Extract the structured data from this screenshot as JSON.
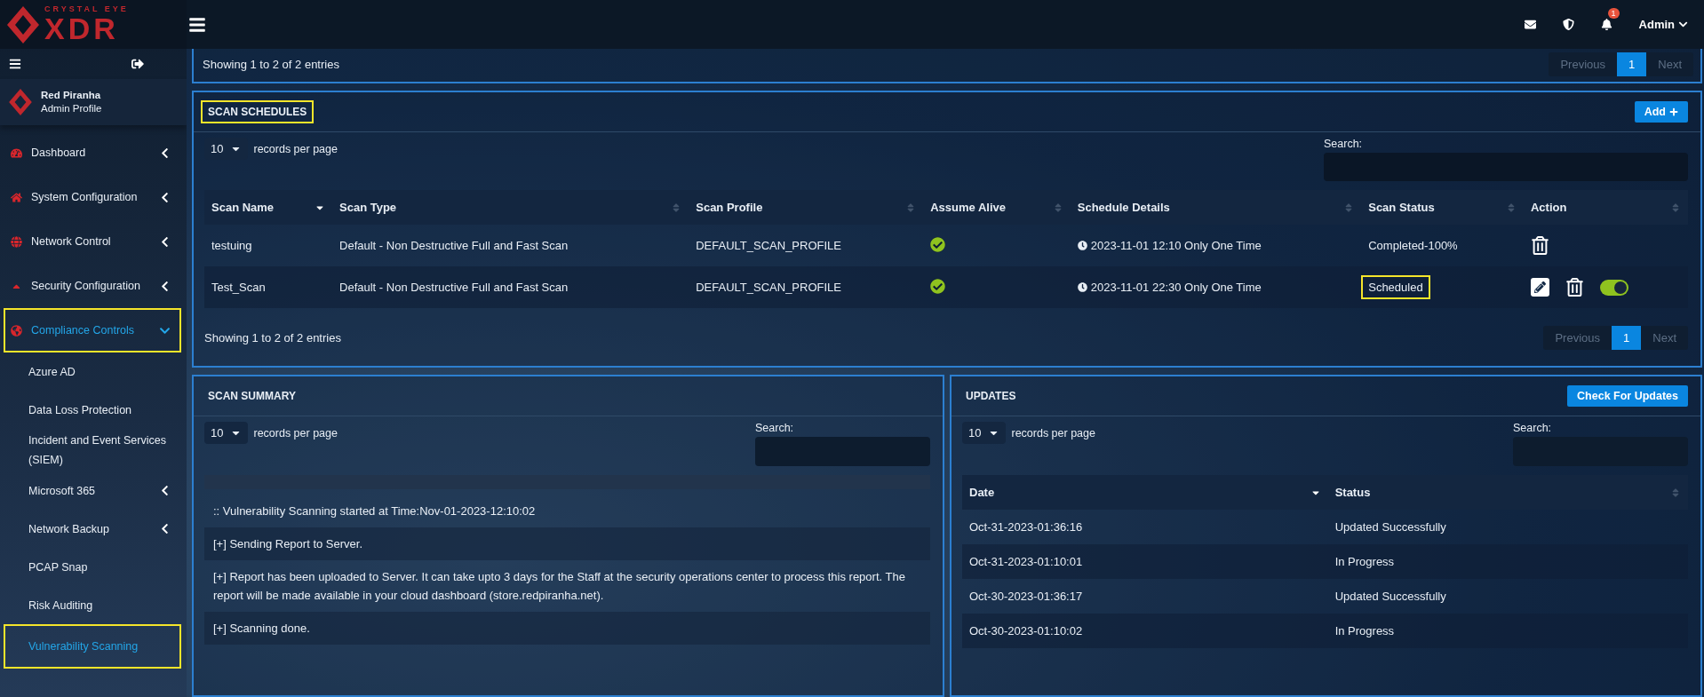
{
  "brand": {
    "top": "CRYSTAL EYE",
    "main": "XDR"
  },
  "header": {
    "notifications": "1",
    "user": "Admin"
  },
  "profile": {
    "name": "Red Piranha",
    "role": "Admin Profile"
  },
  "sidebar": {
    "items": [
      {
        "label": "Dashboard",
        "selected": false,
        "highlighted": false,
        "expanded": false
      },
      {
        "label": "System Configuration",
        "selected": false,
        "highlighted": false,
        "expanded": false
      },
      {
        "label": "Network Control",
        "selected": false,
        "highlighted": false,
        "expanded": false
      },
      {
        "label": "Security Configuration",
        "selected": false,
        "highlighted": false,
        "expanded": false
      },
      {
        "label": "Compliance Controls",
        "selected": true,
        "highlighted": true,
        "expanded": true,
        "children": [
          {
            "label": "Azure AD",
            "selected": false,
            "highlighted": false
          },
          {
            "label": "Data Loss Protection",
            "selected": false,
            "highlighted": false
          },
          {
            "label": "Incident and Event Services (SIEM)",
            "selected": false,
            "highlighted": false
          },
          {
            "label": "Microsoft 365",
            "selected": false,
            "highlighted": false,
            "expanded": false
          },
          {
            "label": "Network Backup",
            "selected": false,
            "highlighted": false,
            "expanded": false
          },
          {
            "label": "PCAP Snap",
            "selected": false,
            "highlighted": false
          },
          {
            "label": "Risk Auditing",
            "selected": false,
            "highlighted": false
          },
          {
            "label": "Vulnerability Scanning",
            "selected": true,
            "highlighted": true
          }
        ]
      }
    ]
  },
  "top_card": {
    "info": "Showing 1 to 2 of 2 entries",
    "pagination": [
      {
        "label": "Previous",
        "selected": false
      },
      {
        "label": "1",
        "selected": true
      },
      {
        "label": "Next",
        "selected": false
      }
    ]
  },
  "scan_schedules": {
    "title": "SCAN SCHEDULES",
    "title_highlighted": true,
    "add_button": "Add",
    "page_size": "10",
    "page_size_label": "records per page",
    "search_label": "Search:",
    "columns": [
      {
        "label": "Scan Name",
        "sorted": true
      },
      {
        "label": "Scan Type",
        "sorted": false
      },
      {
        "label": "Scan Profile",
        "sorted": false
      },
      {
        "label": "Assume Alive",
        "sorted": false
      },
      {
        "label": "Schedule Details",
        "sorted": false
      },
      {
        "label": "Scan Status",
        "sorted": false
      },
      {
        "label": "Action",
        "sorted": false
      }
    ],
    "rows": [
      {
        "name": "testuing",
        "type": "Default - Non Destructive Full and Fast Scan",
        "profile": "DEFAULT_SCAN_PROFILE",
        "assume_alive": true,
        "schedule": "2023-11-01 12:10 Only One Time",
        "status": "Completed-100%",
        "status_highlighted": false,
        "actions": [
          {
            "kind": "delete"
          }
        ]
      },
      {
        "name": "Test_Scan",
        "type": "Default - Non Destructive Full and Fast Scan",
        "profile": "DEFAULT_SCAN_PROFILE",
        "assume_alive": true,
        "schedule": "2023-11-01 22:30 Only One Time",
        "status": "Scheduled",
        "status_highlighted": true,
        "actions": [
          {
            "kind": "edit"
          },
          {
            "kind": "delete"
          },
          {
            "kind": "toggle",
            "on": true
          }
        ]
      }
    ],
    "info": "Showing 1 to 2 of 2 entries",
    "pagination": [
      {
        "label": "Previous",
        "selected": false
      },
      {
        "label": "1",
        "selected": true
      },
      {
        "label": "Next",
        "selected": false
      }
    ]
  },
  "scan_summary": {
    "title": "SCAN SUMMARY",
    "page_size": "10",
    "page_size_label": "records per page",
    "search_label": "Search:",
    "rows": [
      ":: Vulnerability Scanning started at Time:Nov-01-2023-12:10:02",
      "[+] Sending Report to Server.",
      "[+] Report has been uploaded to Server. It can take upto 3 days for the Staff at the security operations center to process this report. The report will be made available in your cloud dashboard (store.redpiranha.net).",
      "[+] Scanning done."
    ]
  },
  "updates": {
    "title": "UPDATES",
    "button": "Check For Updates",
    "page_size": "10",
    "page_size_label": "records per page",
    "search_label": "Search:",
    "columns": [
      {
        "label": "Date",
        "sorted": true
      },
      {
        "label": "Status",
        "sorted": false
      }
    ],
    "rows": [
      {
        "date": "Oct-31-2023-01:36:16",
        "status": "Updated Successfully"
      },
      {
        "date": "Oct-31-2023-01:10:01",
        "status": "In Progress"
      },
      {
        "date": "Oct-30-2023-01:36:17",
        "status": "Updated Successfully"
      },
      {
        "date": "Oct-30-2023-01:10:02",
        "status": "In Progress"
      }
    ]
  }
}
